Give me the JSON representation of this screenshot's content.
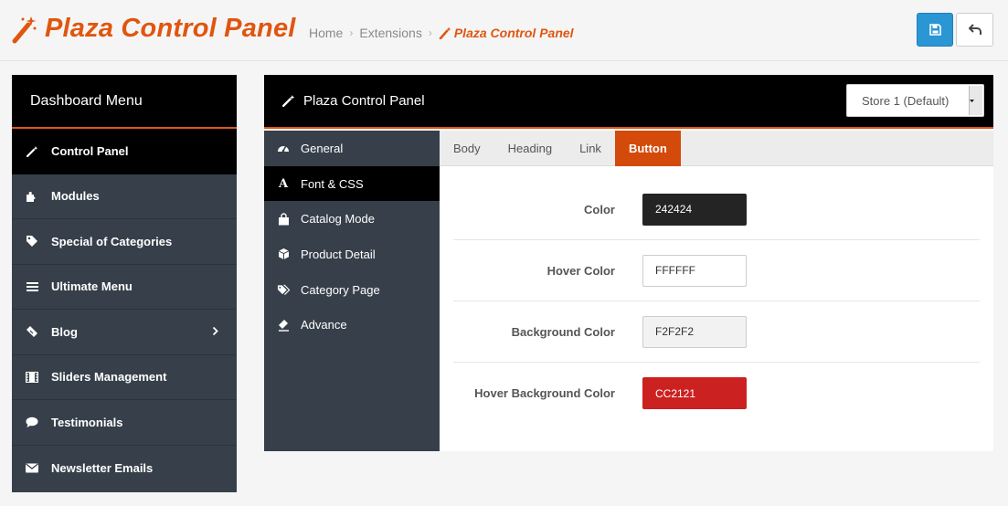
{
  "header": {
    "title": "Plaza Control Panel",
    "breadcrumbs": [
      "Home",
      "Extensions",
      "Plaza Control Panel"
    ],
    "breadcrumb_separator": "›",
    "save_icon": "save-icon",
    "back_icon": "reply-icon"
  },
  "dashboard": {
    "title": "Dashboard Menu",
    "items": [
      {
        "label": "Control Panel",
        "icon": "magic-wand-icon"
      },
      {
        "label": "Modules",
        "icon": "puzzle-icon"
      },
      {
        "label": "Special of Categories",
        "icon": "tag-icon"
      },
      {
        "label": "Ultimate Menu",
        "icon": "bars-icon"
      },
      {
        "label": "Blog",
        "icon": "ticket-icon"
      },
      {
        "label": "Sliders Management",
        "icon": "film-icon"
      },
      {
        "label": "Testimonials",
        "icon": "comment-icon"
      },
      {
        "label": "Newsletter Emails",
        "icon": "envelope-icon"
      }
    ]
  },
  "panel": {
    "title": "Plaza Control Panel",
    "store_select": "Store 1 (Default)",
    "subnav": [
      {
        "label": "General",
        "icon": "dashboard-icon"
      },
      {
        "label": "Font & CSS",
        "icon": "font-icon",
        "glyph": "A"
      },
      {
        "label": "Catalog Mode",
        "icon": "shopping-bag-icon"
      },
      {
        "label": "Product Detail",
        "icon": "cube-icon"
      },
      {
        "label": "Category Page",
        "icon": "tags-icon"
      },
      {
        "label": "Advance",
        "icon": "eraser-icon"
      }
    ],
    "tabs": [
      "Body",
      "Heading",
      "Link",
      "Button"
    ],
    "fields": [
      {
        "label": "Color",
        "value": "242424",
        "bg": "#242424",
        "fg": "#ffffff"
      },
      {
        "label": "Hover Color",
        "value": "FFFFFF",
        "bg": "#ffffff",
        "fg": "#333333"
      },
      {
        "label": "Background Color",
        "value": "F2F2F2",
        "bg": "#f2f2f2",
        "fg": "#333333"
      },
      {
        "label": "Hover Background Color",
        "value": "CC2121",
        "bg": "#cc2121",
        "fg": "#ffffff"
      }
    ]
  },
  "colors": {
    "accent": "#e0560f",
    "tab_active": "#d44a0a",
    "sidebar": "#37404a",
    "save_button": "#2a96d4"
  }
}
